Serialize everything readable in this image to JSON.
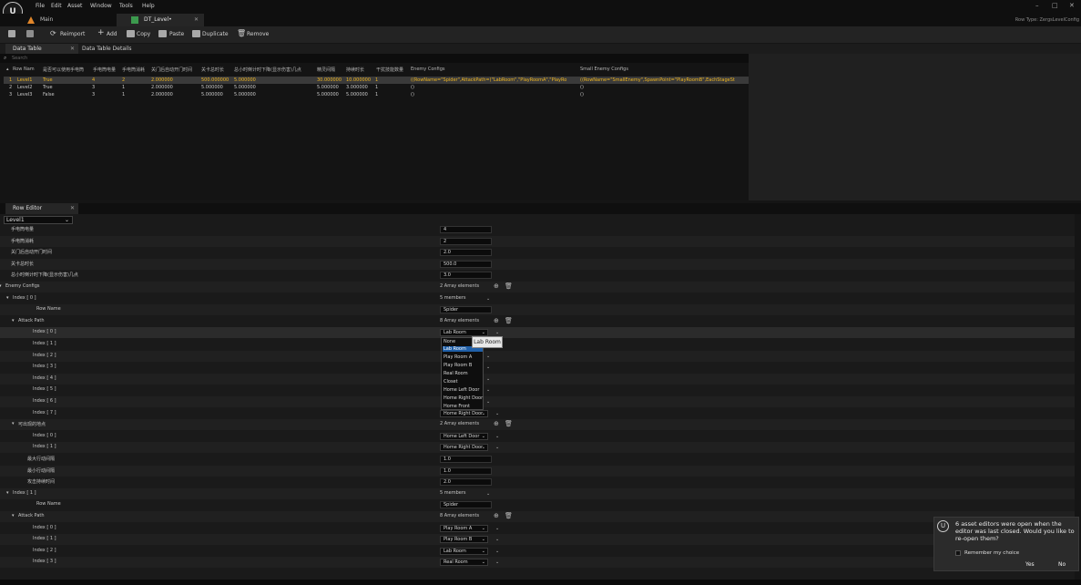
{
  "menu": {
    "items": [
      "File",
      "Edit",
      "Asset",
      "Window",
      "Tools",
      "Help"
    ]
  },
  "window": {
    "right_label": "Row Type: ZergsLevelConfig"
  },
  "tabs": [
    {
      "label": "Main"
    },
    {
      "label": "DT_Level•"
    }
  ],
  "toolbar": {
    "reimport": "Reimport",
    "add": "Add",
    "copy": "Copy",
    "paste": "Paste",
    "duplicate": "Duplicate",
    "remove": "Remove"
  },
  "subtabs": {
    "data_table": "Data Table",
    "details": "Data Table Details"
  },
  "search": {
    "placeholder": "Search"
  },
  "table": {
    "headers": [
      "Row Nam",
      "是否可以使用手电筒",
      "手电筒电量",
      "手电筒消耗",
      "关门后自动开门时间",
      "关卡总时长",
      "总小时倒计时下降(显示伤害)几点",
      "精灵间隔",
      "持续时长",
      "干扰技能数量",
      "Enemy Configs",
      "Small Enemy Configs"
    ],
    "rows": [
      {
        "idx": "1",
        "name": "Level1",
        "c1": "True",
        "c2": "4",
        "c3": "2",
        "c4": "2.000000",
        "c5": "500.000000",
        "c6": "5.000000",
        "c7": "30.000000",
        "c8": "10.000000",
        "c9": "1",
        "enemy": "((RowName=\"Spider\",AttackPath=(\"LabRoom\",\"PlayRoomA\",\"PlayRo",
        "small": "((RowName=\"SmallEnemy\",SpawnPoint=\"PlayRoomB\",EachStageSt"
      },
      {
        "idx": "2",
        "name": "Level2",
        "c1": "True",
        "c2": "3",
        "c3": "1",
        "c4": "2.000000",
        "c5": "5.000000",
        "c6": "5.000000",
        "c7": "5.000000",
        "c8": "3.000000",
        "c9": "1",
        "enemy": "()",
        "small": "()"
      },
      {
        "idx": "3",
        "name": "Level3",
        "c1": "False",
        "c2": "3",
        "c3": "1",
        "c4": "2.000000",
        "c5": "5.000000",
        "c6": "5.000000",
        "c7": "5.000000",
        "c8": "5.000000",
        "c9": "1",
        "enemy": "()",
        "small": "()"
      }
    ]
  },
  "row_editor": {
    "tab": "Row Editor",
    "selected_row": "Level1",
    "props": [
      {
        "label": "手电筒电量",
        "value": "4",
        "kind": "box"
      },
      {
        "label": "手电筒消耗",
        "value": "2",
        "kind": "box"
      },
      {
        "label": "关门后自动开门时间",
        "value": "2.0",
        "kind": "box"
      },
      {
        "label": "关卡总时长",
        "value": "500.0",
        "kind": "box"
      },
      {
        "label": "总小时倒计时下降(显示伤害)几点",
        "value": "3.0",
        "kind": "box"
      },
      {
        "label": "Enemy Configs",
        "value": "2 Array elements",
        "kind": "array"
      },
      {
        "label": "Index [ 0 ]",
        "value": "5 members",
        "kind": "members"
      },
      {
        "label": "Row Name",
        "value": "Spider",
        "kind": "box"
      },
      {
        "label": "Attack Path",
        "value": "8 Array elements",
        "kind": "array"
      },
      {
        "label": "Index [ 0 ]",
        "value": "Lab Room",
        "kind": "combo"
      },
      {
        "label": "Index [ 1 ]",
        "value": "",
        "kind": "ddrow"
      },
      {
        "label": "Index [ 2 ]",
        "value": "",
        "kind": "ddrow"
      },
      {
        "label": "Index [ 3 ]",
        "value": "",
        "kind": "ddrow"
      },
      {
        "label": "Index [ 4 ]",
        "value": "",
        "kind": "ddrow"
      },
      {
        "label": "Index [ 5 ]",
        "value": "",
        "kind": "ddrow"
      },
      {
        "label": "Index [ 6 ]",
        "value": "",
        "kind": "ddrow"
      },
      {
        "label": "Index [ 7 ]",
        "value": "Home Right Door",
        "kind": "combo"
      },
      {
        "label": "可出现的地点",
        "value": "2 Array elements",
        "kind": "array"
      },
      {
        "label": "Index [ 0 ]",
        "value": "Home Left Door",
        "kind": "combo"
      },
      {
        "label": "Index [ 1 ]",
        "value": "Home Right Door",
        "kind": "combo"
      },
      {
        "label": "最大行动间隔",
        "value": "1.0",
        "kind": "box"
      },
      {
        "label": "最小行动间隔",
        "value": "1.0",
        "kind": "box"
      },
      {
        "label": "攻击持续时间",
        "value": "2.0",
        "kind": "box"
      },
      {
        "label": "Index [ 1 ]",
        "value": "5 members",
        "kind": "members"
      },
      {
        "label": "Row Name",
        "value": "Spider",
        "kind": "box"
      },
      {
        "label": "Attack Path",
        "value": "8 Array elements",
        "kind": "array"
      },
      {
        "label": "Index [ 0 ]",
        "value": "Play Room A",
        "kind": "combo"
      },
      {
        "label": "Index [ 1 ]",
        "value": "Play Room B",
        "kind": "combo"
      },
      {
        "label": "Index [ 2 ]",
        "value": "Lab Room",
        "kind": "combo"
      },
      {
        "label": "Index [ 3 ]",
        "value": "Real Room",
        "kind": "combo"
      }
    ],
    "dropdown": [
      "None",
      "Lab Room",
      "Play Room A",
      "Play Room B",
      "Real Room",
      "Closet",
      "Home Left Door",
      "Home Right Door",
      "Home Front"
    ],
    "dropdown_selected": 1,
    "tooltip": "Lab Room"
  },
  "notification": {
    "message": "6 asset editors were open when the editor was last closed. Would you like to re-open them?",
    "remember": "Remember my choice",
    "yes": "Yes",
    "no": "No"
  },
  "colors": {
    "selected_row": "#ffc333",
    "accent": "#1f5fa8"
  }
}
